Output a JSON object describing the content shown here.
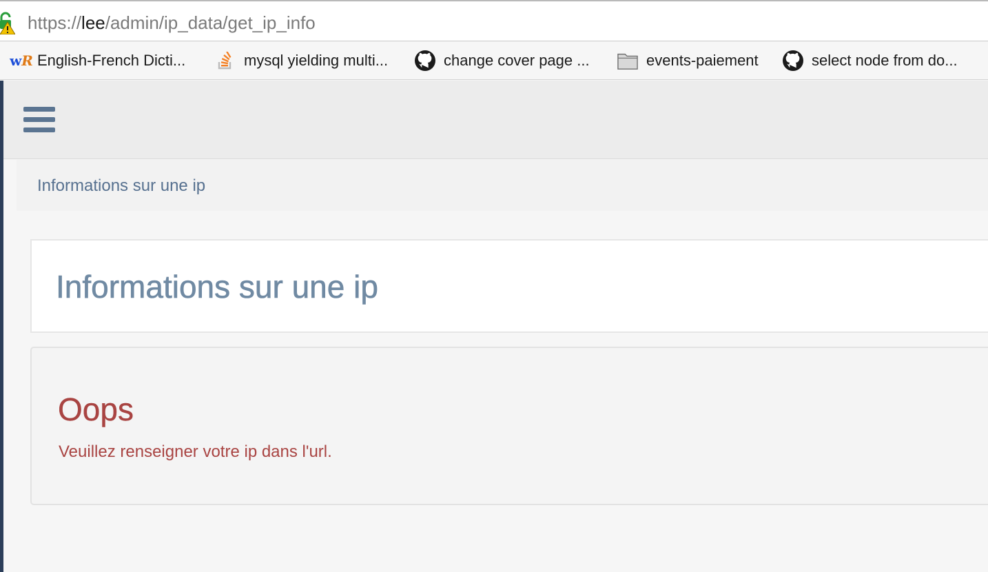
{
  "browser": {
    "url": {
      "scheme": "https://",
      "host": "lee",
      "path": "/admin/ip_data/get_ip_info"
    },
    "bookmarks": [
      {
        "label": "English-French Dicti...",
        "icon": "wordreference-icon"
      },
      {
        "label": "mysql yielding multi...",
        "icon": "stackoverflow-icon"
      },
      {
        "label": "change cover page ...",
        "icon": "github-icon"
      },
      {
        "label": "events-paiement",
        "icon": "folder-icon"
      },
      {
        "label": "select node from do...",
        "icon": "github-icon"
      }
    ]
  },
  "app": {
    "menu_icon": "hamburger-icon",
    "breadcrumb": "Informations sur une ip",
    "page_title": "Informations sur une ip",
    "error": {
      "title": "Oops",
      "message": "Veuillez renseigner votre ip dans l'url."
    }
  },
  "colors": {
    "rail": "#2c3e5a",
    "title": "#708aa3",
    "error": "#a94442",
    "breadcrumb": "#56708f"
  }
}
